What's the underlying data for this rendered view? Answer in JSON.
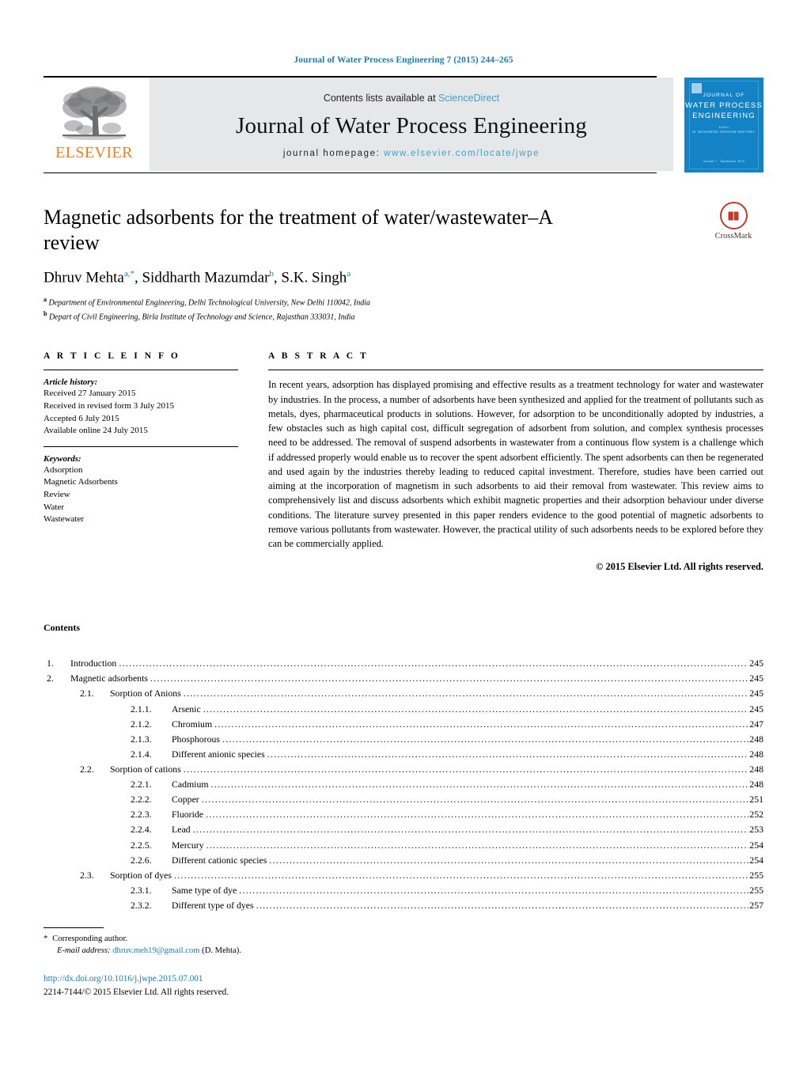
{
  "running_head": "Journal of Water Process Engineering 7 (2015) 244–265",
  "masthead": {
    "publisher_logo_text": "ELSEVIER",
    "contents_prefix": "Contents lists available at",
    "contents_link": "ScienceDirect",
    "journal_name": "Journal of Water Process Engineering",
    "homepage_prefix": "journal homepage:",
    "homepage_url": "www.elsevier.com/locate/jwpe",
    "cover": {
      "line1": "JOURNAL OF",
      "line2": "WATER PROCESS",
      "line3": "ENGINEERING",
      "sub1": "Editor",
      "sub2": "M. MAKOWSKI     GRAHAM WHITNEY",
      "footer": "Volume 7 · September 2015"
    }
  },
  "article": {
    "title": "Magnetic adsorbents for the treatment of water/wastewater–A review",
    "authors": [
      {
        "name": "Dhruv Mehta",
        "marks": "a,*"
      },
      {
        "name": "Siddharth Mazumdar",
        "marks": "b"
      },
      {
        "name": "S.K. Singh",
        "marks": "a"
      }
    ],
    "affiliations": [
      {
        "mark": "a",
        "text": "Department of Environmental Engineering, Delhi Technological University, New Delhi 110042, India"
      },
      {
        "mark": "b",
        "text": "Depart of Civil Engineering, Birla Institute of Technology and Science, Rajasthan 333031, India"
      }
    ],
    "crossmark_label": "CrossMark"
  },
  "article_info": {
    "heading": "A R T I C L E   I N F O",
    "history_title": "Article history:",
    "history": [
      "Received 27 January 2015",
      "Received in revised form 3 July 2015",
      "Accepted 6 July 2015",
      "Available online 24 July 2015"
    ],
    "keywords_title": "Keywords:",
    "keywords": [
      "Adsorption",
      "Magnetic Adsorbents",
      "Review",
      "Water",
      "Wastewater"
    ]
  },
  "abstract": {
    "heading": "A B S T R A C T",
    "body": "In recent years, adsorption has displayed promising and effective results as a treatment technology for water and wastewater by industries. In the process, a number of adsorbents have been synthesized and applied for the treatment of pollutants such as metals, dyes, pharmaceutical products in solutions. However, for adsorption to be unconditionally adopted by industries, a few obstacles such as high capital cost, difficult segregation of adsorbent from solution, and complex synthesis processes need to be addressed. The removal of suspend adsorbents in wastewater from a continuous flow system is a challenge which if addressed properly would enable us to recover the spent adsorbent efficiently. The spent adsorbents can then be regenerated and used again by the industries thereby leading to reduced capital investment. Therefore, studies have been carried out aiming at the incorporation of magnetism in such adsorbents to aid their removal from wastewater. This review aims to comprehensively list and discuss adsorbents which exhibit magnetic properties and their adsorption behaviour under diverse conditions. The literature survey presented in this paper renders evidence to the good potential of magnetic adsorbents to remove various pollutants from wastewater. However, the practical utility of such adsorbents needs to be explored before they can be commercially applied.",
    "copyright": "© 2015 Elsevier Ltd. All rights reserved."
  },
  "contents": {
    "heading": "Contents",
    "entries": [
      {
        "level": 1,
        "num": "1.",
        "label": "Introduction",
        "page": "245"
      },
      {
        "level": 1,
        "num": "2.",
        "label": "Magnetic adsorbents",
        "page": "245"
      },
      {
        "level": 2,
        "num": "2.1.",
        "label": "Sorption of Anions",
        "page": "245"
      },
      {
        "level": 3,
        "num": "2.1.1.",
        "label": "Arsenic",
        "page": "245"
      },
      {
        "level": 3,
        "num": "2.1.2.",
        "label": "Chromium",
        "page": "247"
      },
      {
        "level": 3,
        "num": "2.1.3.",
        "label": "Phosphorous",
        "page": "248"
      },
      {
        "level": 3,
        "num": "2.1.4.",
        "label": "Different anionic species",
        "page": "248"
      },
      {
        "level": 2,
        "num": "2.2.",
        "label": "Sorption of cations",
        "page": "248"
      },
      {
        "level": 3,
        "num": "2.2.1.",
        "label": "Cadmium",
        "page": "248"
      },
      {
        "level": 3,
        "num": "2.2.2.",
        "label": "Copper",
        "page": "251"
      },
      {
        "level": 3,
        "num": "2.2.3.",
        "label": "Fluoride",
        "page": "252"
      },
      {
        "level": 3,
        "num": "2.2.4.",
        "label": "Lead",
        "page": "253"
      },
      {
        "level": 3,
        "num": "2.2.5.",
        "label": "Mercury",
        "page": "254"
      },
      {
        "level": 3,
        "num": "2.2.6.",
        "label": "Different cationic species",
        "page": "254"
      },
      {
        "level": 2,
        "num": "2.3.",
        "label": "Sorption of dyes",
        "page": "255"
      },
      {
        "level": 3,
        "num": "2.3.1.",
        "label": "Same type of dye",
        "page": "255"
      },
      {
        "level": 3,
        "num": "2.3.2.",
        "label": "Different type of dyes",
        "page": "257"
      }
    ]
  },
  "footnote": {
    "star": "*",
    "corresponding": "Corresponding author.",
    "email_label": "E-mail address:",
    "email": "dhruv.meh19@gmail.com",
    "email_owner": "(D. Mehta).",
    "doi": "http://dx.doi.org/10.1016/j.jwpe.2015.07.001",
    "issn_line": "2214-7144/© 2015 Elsevier Ltd. All rights reserved."
  },
  "colors": {
    "link_blue": "#1a7eb5",
    "band_gray": "#e6e7e8",
    "elsevier_orange": "#f07f1a",
    "cover_blue": "#1383c6",
    "crossmark_red": "#c03a2b"
  }
}
